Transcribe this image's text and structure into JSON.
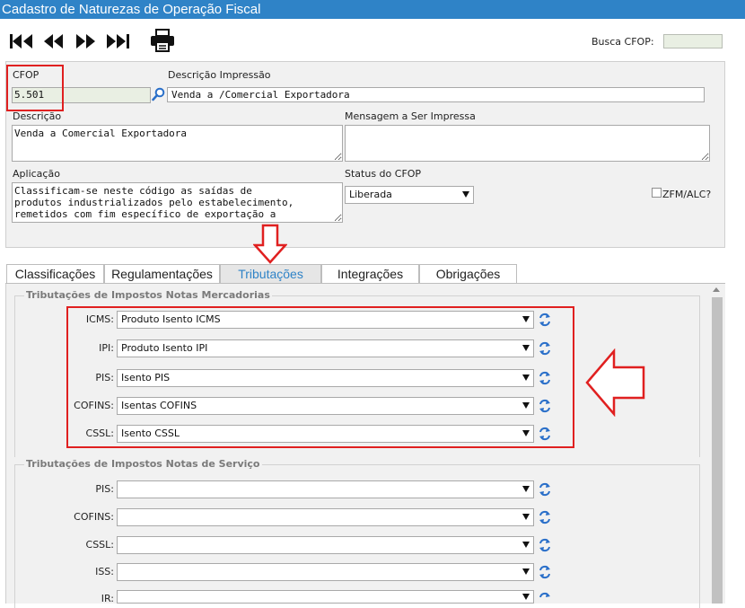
{
  "window": {
    "title": "Cadastro de Naturezas de Operação Fiscal"
  },
  "toolbar": {
    "buttons": [
      {
        "name": "first-record-button",
        "icon": "first-icon"
      },
      {
        "name": "previous-record-button",
        "icon": "previous-icon"
      },
      {
        "name": "next-record-button",
        "icon": "next-icon"
      },
      {
        "name": "last-record-button",
        "icon": "last-icon"
      },
      {
        "name": "print-button",
        "icon": "printer-icon"
      }
    ],
    "busca_label": "Busca CFOP:",
    "busca_value": ""
  },
  "form": {
    "cfop_label": "CFOP",
    "cfop_value": "5.501",
    "descricao_impressao_label": "Descrição Impressão",
    "descricao_impressao_value": "Venda a /Comercial Exportadora",
    "descricao_label": "Descrição",
    "descricao_value": "Venda a Comercial Exportadora",
    "mensagem_label": "Mensagem a Ser Impressa",
    "mensagem_value": "",
    "aplicacao_label": "Aplicação",
    "aplicacao_value": "Classificam-se neste código as saídas de\nprodutos industrializados pelo estabelecimento,\nremetidos com fim específico de exportação a",
    "status_label": "Status do CFOP",
    "status_value": "Liberada",
    "zfm_label": "ZFM/ALC?",
    "zfm_checked": false
  },
  "tabs": [
    {
      "label": "Classificações",
      "active": false
    },
    {
      "label": "Regulamentações",
      "active": false
    },
    {
      "label": "Tributações",
      "active": true
    },
    {
      "label": "Integrações",
      "active": false
    },
    {
      "label": "Obrigações",
      "active": false
    }
  ],
  "tributacoes": {
    "mercadorias": {
      "legend": "Tributações de Impostos Notas Mercadorias",
      "rows": [
        {
          "label": "ICMS:",
          "value": "Produto Isento ICMS"
        },
        {
          "label": "IPI:",
          "value": "Produto Isento IPI"
        },
        {
          "label": "PIS:",
          "value": "Isento PIS"
        },
        {
          "label": "COFINS:",
          "value": "Isentas COFINS"
        },
        {
          "label": "CSSL:",
          "value": "Isento CSSL"
        }
      ]
    },
    "servico": {
      "legend": "Tributações de Impostos Notas de Serviço",
      "rows": [
        {
          "label": "PIS:",
          "value": ""
        },
        {
          "label": "COFINS:",
          "value": ""
        },
        {
          "label": "CSSL:",
          "value": ""
        },
        {
          "label": "ISS:",
          "value": ""
        },
        {
          "label": "IR:",
          "value": ""
        }
      ]
    }
  },
  "colors": {
    "titlebar": "#2f83c7",
    "annotation": "#e02020",
    "active_tab_text": "#2f83c7",
    "refresh_icon": "#2a6fc9"
  }
}
